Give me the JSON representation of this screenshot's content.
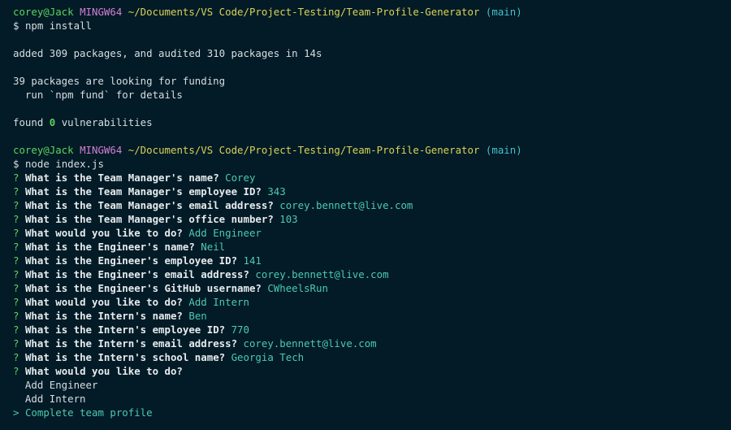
{
  "prompt": {
    "user": "corey@Jack",
    "system": "MINGW64",
    "path": "~/Documents/VS Code/Project-Testing/Team-Profile-Generator",
    "branch": "(main)",
    "symbol": "$"
  },
  "cmd1": "npm install",
  "output": {
    "added": "added 309 packages, and audited 310 packages in 14s",
    "funding": "39 packages are looking for funding",
    "fund_hint": "  run `npm fund` for details",
    "found_prefix": "found ",
    "found_count": "0",
    "found_suffix": " vulnerabilities"
  },
  "cmd2": "node index.js",
  "qa": [
    {
      "q": "What is the Team Manager's name?",
      "a": "Corey"
    },
    {
      "q": "What is the Team Manager's employee ID?",
      "a": "343"
    },
    {
      "q": "What is the Team Manager's email address?",
      "a": "corey.bennett@live.com"
    },
    {
      "q": "What is the Team Manager's office number?",
      "a": "103"
    },
    {
      "q": "What would you like to do?",
      "a": "Add Engineer"
    },
    {
      "q": "What is the Engineer's name?",
      "a": "Neil"
    },
    {
      "q": "What is the Engineer's employee ID?",
      "a": "141"
    },
    {
      "q": "What is the Engineer's email address?",
      "a": "corey.bennett@live.com"
    },
    {
      "q": "What is the Engineer's GitHub username?",
      "a": "CWheelsRun"
    },
    {
      "q": "What would you like to do?",
      "a": "Add Intern"
    },
    {
      "q": "What is the Intern's name?",
      "a": "Ben"
    },
    {
      "q": "What is the Intern's employee ID?",
      "a": "770"
    },
    {
      "q": "What is the Intern's email address?",
      "a": "corey.bennett@live.com"
    },
    {
      "q": "What is the Intern's school name?",
      "a": "Georgia Tech"
    }
  ],
  "question_mark": "?",
  "final_question": "What would you like to do?",
  "choices": {
    "pointer": ">",
    "items": [
      "Add Engineer",
      "Add Intern",
      "Complete team profile"
    ]
  },
  "colors": {
    "background": "#021b26",
    "prompt_user": "#5fd35f",
    "prompt_system": "#d27fd6",
    "prompt_path": "#d9d35a",
    "prompt_branch": "#46c0c8",
    "answer": "#4ec9b0"
  }
}
